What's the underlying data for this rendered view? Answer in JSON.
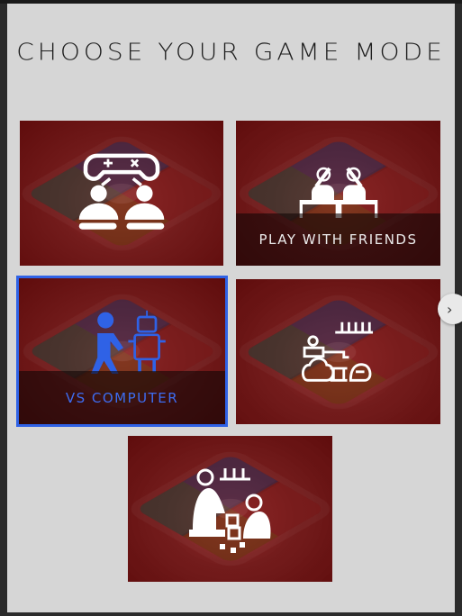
{
  "title": "CHOOSE YOUR GAME MODE",
  "modes": [
    {
      "icon": "two-players-gamepad-icon",
      "label": ""
    },
    {
      "icon": "friends-high-five-icon",
      "label": "PLAY WITH FRIENDS"
    },
    {
      "icon": "player-vs-robot-icon",
      "label": "VS COMPUTER",
      "selected": true
    },
    {
      "icon": "tournament-pieces-icon",
      "label": ""
    },
    {
      "icon": "kids-playing-icon",
      "label": ""
    }
  ],
  "colors": {
    "panel": "#d6d6d6",
    "card": "#6e1212",
    "selected_outline": "#2f62e6",
    "selected_text": "#3d6cf0"
  },
  "nav": {
    "next_icon": "chevron-right-icon",
    "next_glyph": "›"
  }
}
